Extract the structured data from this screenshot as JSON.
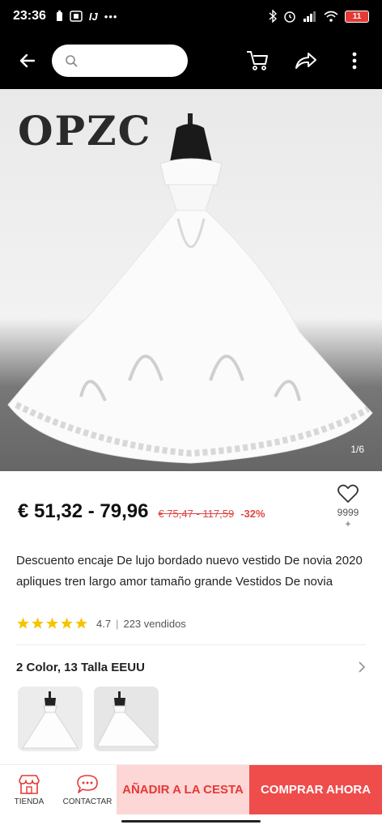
{
  "status_bar": {
    "time": "23:36",
    "battery": "11",
    "left_icons": [
      "battery-saver-icon",
      "notification-icon",
      "app-icon",
      "more-dots-icon"
    ],
    "right_icons": [
      "bluetooth-icon",
      "alarm-icon",
      "signal-icon",
      "wifi-icon"
    ]
  },
  "header": {
    "search_placeholder": "",
    "icons": [
      "back-arrow-icon",
      "search-icon",
      "cart-icon",
      "share-icon",
      "more-vertical-icon"
    ]
  },
  "gallery": {
    "brand": "OPZC",
    "counter": "1/6"
  },
  "product": {
    "price": "€ 51,32 - 79,96",
    "old_price": "€ 75,47 - 117,59",
    "discount": "-32%",
    "wishlist_count": "9999",
    "wishlist_plus": "+",
    "title": "Descuento encaje De lujo bordado nuevo vestido De novia 2020 apliques tren largo amor tamaño grande Vestidos De novia",
    "rating": "4.7",
    "sold": "223 vendidos",
    "stars": 5
  },
  "variants": {
    "label": "2 Color, 13 Talla EEUU",
    "thumbs": [
      "variant-1",
      "variant-2"
    ]
  },
  "bottom_bar": {
    "store_label": "TIENDA",
    "contact_label": "CONTACTAR",
    "add_to_cart": "AÑADIR A LA CESTA",
    "buy_now": "COMPRAR AHORA"
  },
  "colors": {
    "accent": "#ef4c4c",
    "accent_light": "#fdd6d6",
    "price_red": "#e04545",
    "star": "#f5c400"
  }
}
